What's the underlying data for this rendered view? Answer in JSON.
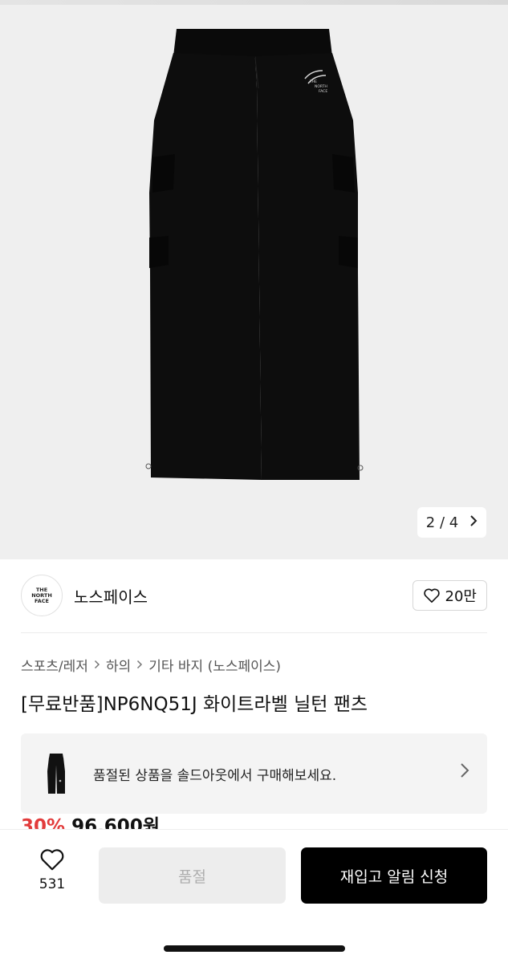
{
  "gallery": {
    "current_page": "2",
    "separator": "/",
    "total_pages": "4",
    "image_logo_text": [
      "THE",
      "NORTH",
      "FACE"
    ]
  },
  "brand": {
    "logo_lines": [
      "THE",
      "NORTH",
      "FACE"
    ],
    "name": "노스페이스",
    "like_count": "20만"
  },
  "breadcrumb": [
    "스포츠/레저",
    "하의",
    "기타 바지 (노스페이스)"
  ],
  "product": {
    "title": "[무료반품]NP6NQ51J 화이트라벨 닐턴 팬츠",
    "discount": "30%",
    "price": "96,600원"
  },
  "banner": {
    "text": "품절된 상품을 솔드아웃에서 구매해보세요."
  },
  "bottom": {
    "wish_count": "531",
    "soldout_label": "품절",
    "restock_label": "재입고 알림 신청"
  },
  "colors": {
    "accent_discount": "#e23b3b",
    "primary_button": "#000000",
    "disabled_button": "#ededed"
  }
}
